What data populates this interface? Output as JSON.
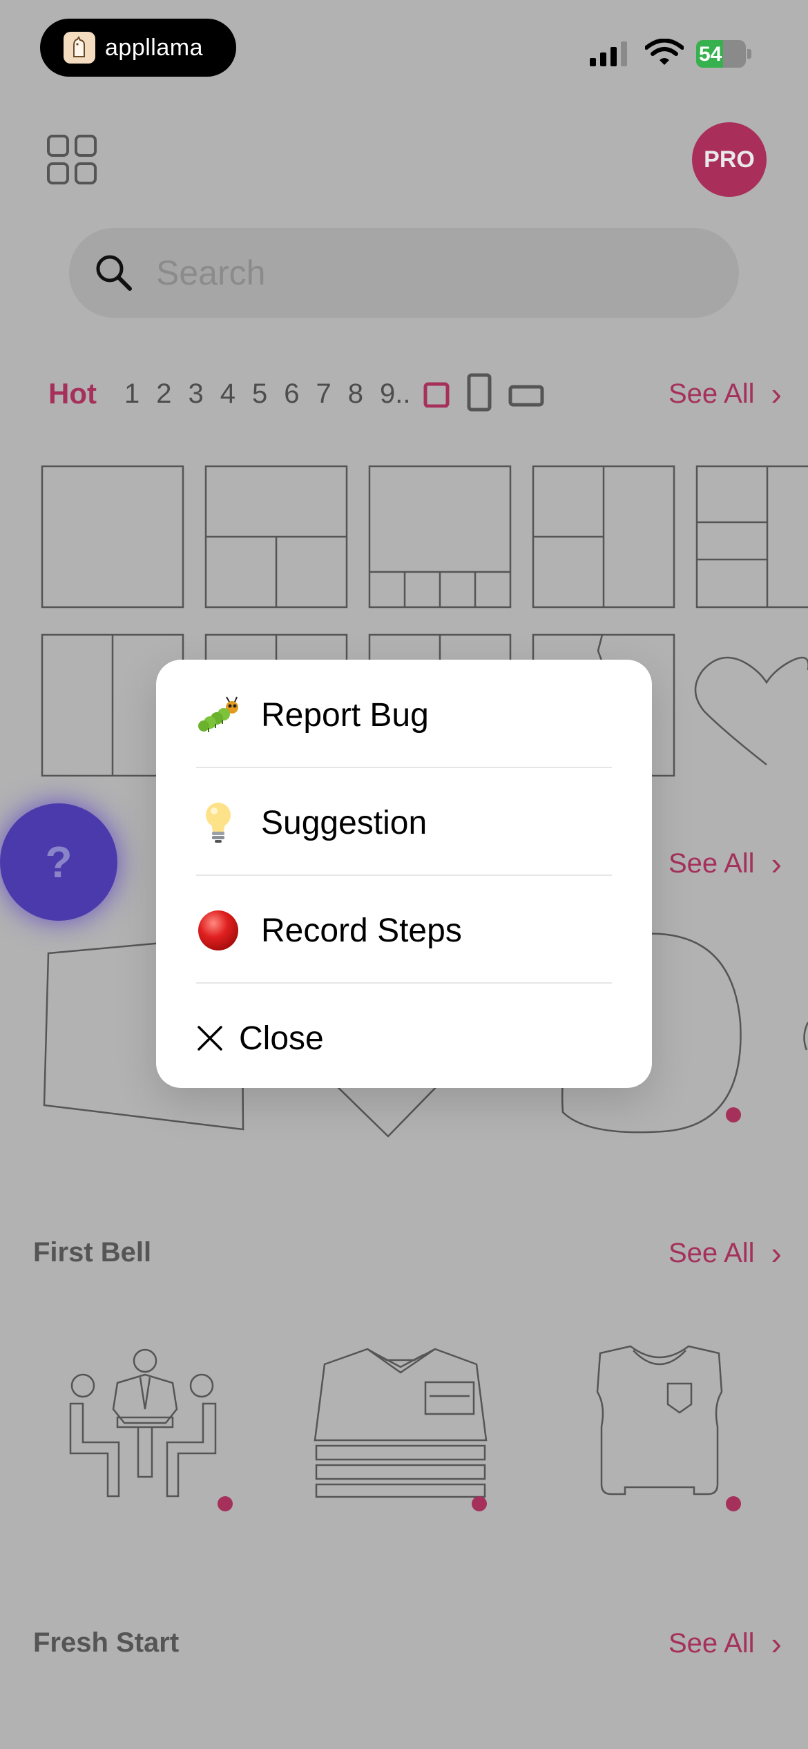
{
  "status_bar": {
    "brand": "appllama",
    "battery": "54",
    "battery_level": 0.54
  },
  "header": {
    "pro_label": "PRO"
  },
  "search": {
    "placeholder": "Search"
  },
  "filters": {
    "hot_label": "Hot",
    "numbers": [
      "1",
      "2",
      "3",
      "4",
      "5",
      "6",
      "7",
      "8",
      "9.."
    ]
  },
  "see_all_label": "See All",
  "sections": {
    "first_bell": "First Bell",
    "fresh_start": "Fresh Start"
  },
  "help_fab": {
    "label": "?"
  },
  "feedback_menu": {
    "items": [
      {
        "label": "Report Bug",
        "icon": "caterpillar-emoji"
      },
      {
        "label": "Suggestion",
        "icon": "lightbulb-emoji"
      },
      {
        "label": "Record Steps",
        "icon": "red-circle-emoji"
      }
    ],
    "close_label": "Close"
  },
  "colors": {
    "accent": "#a5315b",
    "overlay_bg": "#b2b2b2",
    "help_fab": "#4a3aab"
  }
}
